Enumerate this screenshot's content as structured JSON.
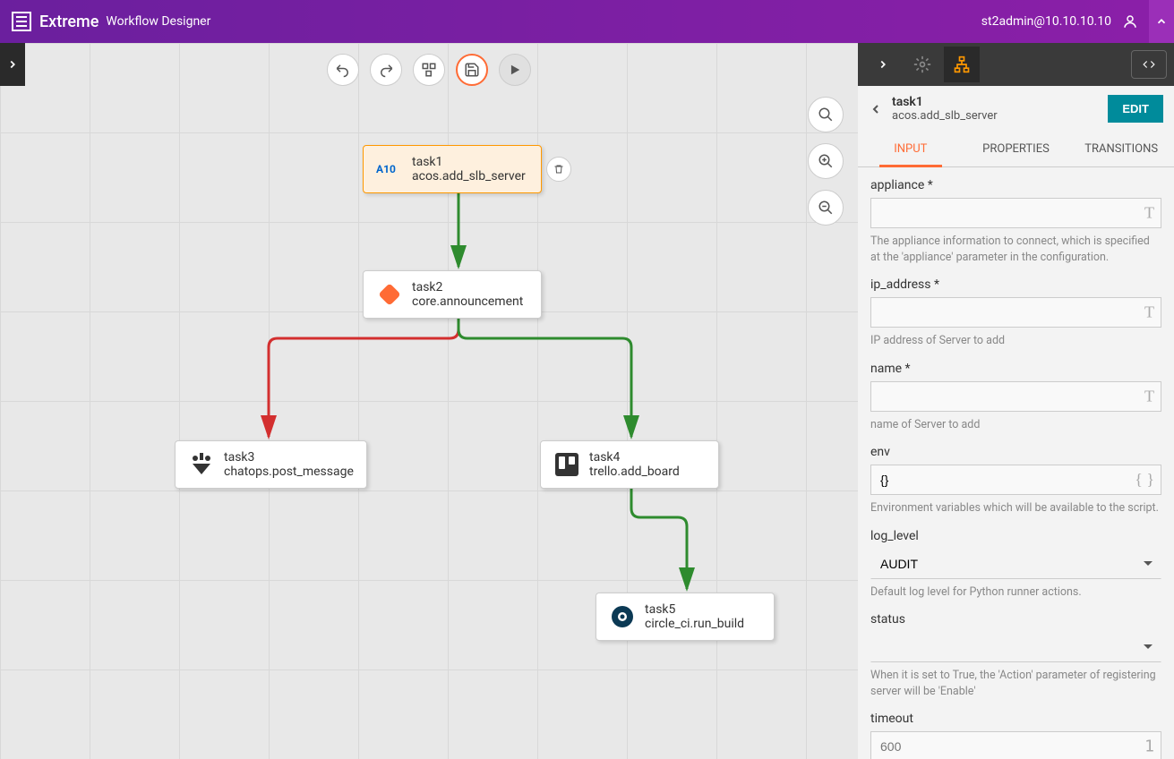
{
  "header": {
    "brand": "Extreme",
    "app_title": "Workflow Designer",
    "user": "st2admin@10.10.10.10"
  },
  "tasks": {
    "task1": {
      "name": "task1",
      "action": "acos.add_slb_server"
    },
    "task2": {
      "name": "task2",
      "action": "core.announcement"
    },
    "task3": {
      "name": "task3",
      "action": "chatops.post_message"
    },
    "task4": {
      "name": "task4",
      "action": "trello.add_board"
    },
    "task5": {
      "name": "task5",
      "action": "circle_ci.run_build"
    }
  },
  "panel": {
    "task_name": "task1",
    "task_action": "acos.add_slb_server",
    "edit_label": "EDIT",
    "tabs": {
      "input": "INPUT",
      "properties": "PROPERTIES",
      "transitions": "TRANSITIONS"
    },
    "fields": {
      "appliance": {
        "label": "appliance *",
        "help": "The appliance information to connect, which is specified at the 'appliance' parameter in the configuration."
      },
      "ip_address": {
        "label": "ip_address *",
        "help": "IP address of Server to add"
      },
      "name": {
        "label": "name *",
        "help": "name of Server to add"
      },
      "env": {
        "label": "env",
        "value": "{}",
        "help": "Environment variables which will be available to the script."
      },
      "log_level": {
        "label": "log_level",
        "value": "AUDIT",
        "help": "Default log level for Python runner actions."
      },
      "status": {
        "label": "status",
        "value": "",
        "help": "When it is set to True, the 'Action' parameter of registering server will be 'Enable'"
      },
      "timeout": {
        "label": "timeout",
        "placeholder": "600"
      }
    }
  }
}
